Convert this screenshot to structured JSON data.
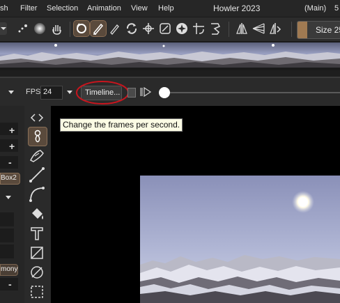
{
  "menu": {
    "items": [
      "sh",
      "Filter",
      "Selection",
      "Animation",
      "View",
      "Help"
    ],
    "app_title": "Howler 2023",
    "workspace": "(Main)",
    "right_fragment": "5"
  },
  "toolbar": {
    "size_label": "Size 25",
    "brush_color": "#a07a52"
  },
  "animation_bar": {
    "fps_label": "FPS",
    "fps_value": "24",
    "timeline_button": "Timeline...",
    "timeline_highlight_color": "#c8151e",
    "playhead_fraction": 0.0
  },
  "tooltip": {
    "text": "Change the frames per second."
  },
  "left_panel": {
    "box_label": "Box2",
    "harmony_label": "mony",
    "plus_labels": [
      "+",
      "+"
    ],
    "minus_labels": [
      "-",
      "-"
    ]
  },
  "tools": [
    "code-brackets-icon",
    "brush-stroke-icon",
    "smudge-brush-icon",
    "line-icon",
    "curve-icon",
    "fill-bucket-icon",
    "text-tool-icon",
    "crossed-square-icon",
    "no-symbol-icon",
    "marquee-selection-icon"
  ]
}
